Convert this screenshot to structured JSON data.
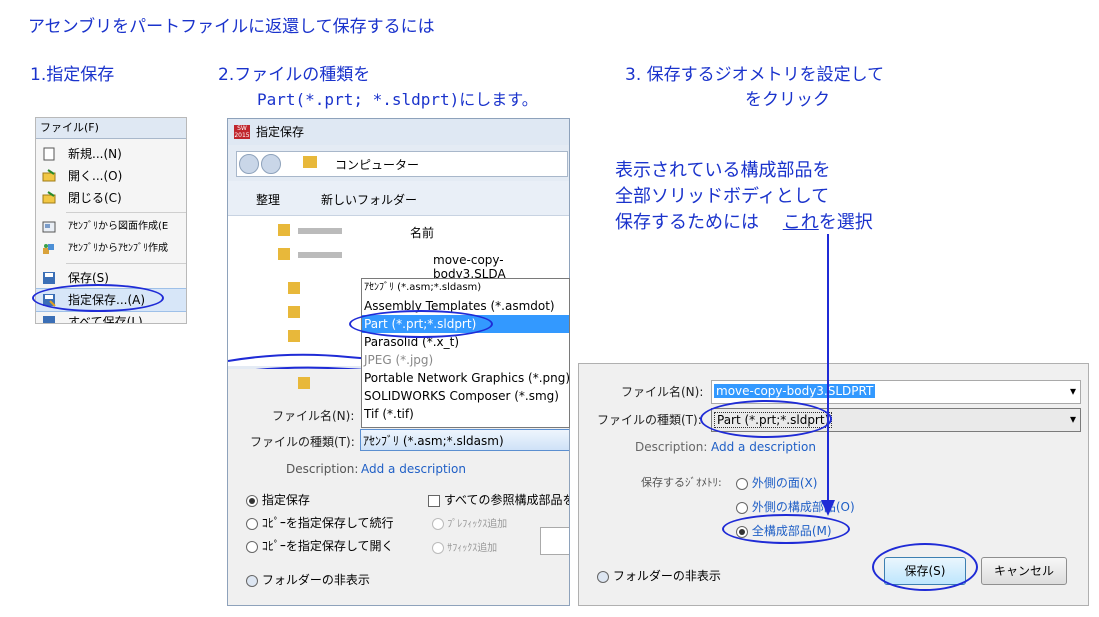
{
  "page_title": "アセンブリをパートファイルに返還して保存するには",
  "steps": {
    "step1": "1.指定保存",
    "step2_line1": "2.ファイルの種類を",
    "step2_line2": "Part(*.prt; *.sldprt)にします。",
    "step3_line1": "3. 保存するジオメトリを設定して",
    "step3_line2": "をクリック"
  },
  "annotation": {
    "line1": "表示されている構成部品を",
    "line2": "全部ソリッドボディとして",
    "line3_prefix": "保存するためには",
    "line3_this": "これ",
    "line3_suffix": "を選択"
  },
  "file_menu": {
    "menubar_label": "ファイル(F)",
    "items": [
      {
        "label": "新規...(N)",
        "icon": "new-doc-icon"
      },
      {
        "label": "開く...(O)",
        "icon": "open-folder-icon"
      },
      {
        "label": "閉じる(C)",
        "icon": "close-folder-icon"
      },
      {
        "label": "ｱｾﾝﾌﾞﾘから図面作成(E",
        "icon": "drawing-icon"
      },
      {
        "label": "ｱｾﾝﾌﾞﾘからｱｾﾝﾌﾞﾘ作成",
        "icon": "assembly-icon"
      },
      {
        "label": "保存(S)",
        "icon": "save-icon"
      },
      {
        "label": "指定保存...(A)",
        "icon": "save-as-icon"
      },
      {
        "label": "すべて保存(L)",
        "icon": "save-all-icon"
      }
    ]
  },
  "save_dialog": {
    "title": "指定保存",
    "app_badge": "SW 2015",
    "breadcrumb": "コンピューター",
    "organize": "整理",
    "new_folder": "新しいフォルダー",
    "column_name": "名前",
    "file_item": "move-copy-body3.SLDA",
    "filename_label": "ファイル名(N):",
    "filetype_label": "ファイルの種類(T):",
    "filetype_value": "ｱｾﾝﾌﾞﾘ (*.asm;*.sldasm)",
    "description_label": "Description:",
    "description_link": "Add a description",
    "radio_save_as": "指定保存",
    "radio_copy_continue": "ｺﾋﾟｰを指定保存して続行",
    "radio_copy_open": "ｺﾋﾟｰを指定保存して開く",
    "check_all_refs": "すべての参照構成部品を",
    "radio_prefix": "ﾌﾟﾚﾌｨｯｸｽ追加",
    "radio_suffix": "ｻﾌｨｯｸｽ追加",
    "hide_folders": "フォルダーの非表示"
  },
  "filetype_dropdown": {
    "options": [
      "ｱｾﾝﾌﾞﾘ (*.asm;*.sldasm)",
      "Assembly Templates (*.asmdot)",
      "Part (*.prt;*.sldprt)",
      "Parasolid (*.x_t)",
      "JPEG (*.jpg)",
      "Portable Network Graphics (*.png)",
      "SOLIDWORKS Composer (*.smg)",
      "Tif (*.tif)"
    ],
    "selected_index": 2
  },
  "save_dialog2": {
    "filename_label": "ファイル名(N):",
    "filename_value": "move-copy-body3.SLDPRT",
    "filetype_label": "ファイルの種類(T):",
    "filetype_value": "Part (*.prt;*.sldprt)",
    "description_label": "Description:",
    "description_link": "Add a description",
    "geometry_label": "保存するｼﾞｵﾒﾄﾘ:",
    "radio_exterior_faces": "外側の面(X)",
    "radio_exterior_components": "外側の構成部品(O)",
    "radio_all_components": "全構成部品(M)",
    "save_button": "保存(S)",
    "cancel_button": "キャンセル",
    "hide_folders": "フォルダーの非表示"
  },
  "colors": {
    "heading_blue": "#1a33cc",
    "highlight_ellipse": "#1f2bd6",
    "selection_blue": "#3399ff",
    "link_blue": "#1f5fc6"
  }
}
